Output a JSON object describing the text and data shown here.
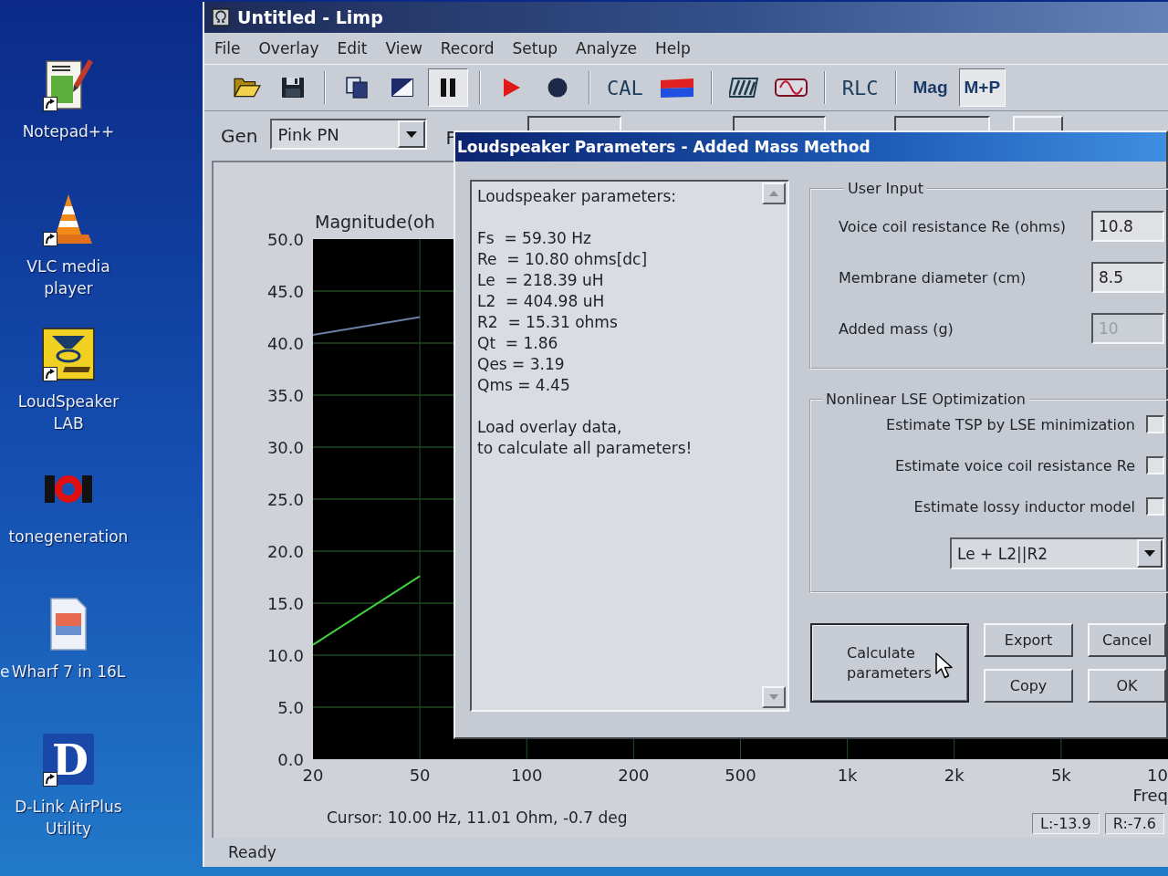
{
  "desktop": {
    "icons": [
      {
        "label": "Notepad++",
        "shortcut": true
      },
      {
        "label": "VLC media player",
        "shortcut": true
      },
      {
        "label": "LoudSpeaker LAB",
        "shortcut": true
      },
      {
        "label": "tonegeneration",
        "shortcut": false
      },
      {
        "label": "Wharf 7 in 16L",
        "shortcut": false
      },
      {
        "label": "D-Link AirPlus Utility",
        "shortcut": true,
        "glyph": "D"
      }
    ],
    "cut_label": "e"
  },
  "window": {
    "title": "Untitled - Limp"
  },
  "menu": [
    "File",
    "Overlay",
    "Edit",
    "View",
    "Record",
    "Setup",
    "Analyze",
    "Help"
  ],
  "toolbar": [
    [
      {
        "kind": "icon",
        "pressed": false
      },
      {
        "kind": "icon",
        "pressed": false
      }
    ],
    [
      {
        "kind": "icon",
        "pressed": false
      },
      {
        "kind": "icon",
        "pressed": false
      },
      {
        "kind": "icon",
        "pressed": true
      }
    ],
    [
      {
        "kind": "icon",
        "pressed": false
      },
      {
        "kind": "icon",
        "pressed": false
      }
    ],
    [
      {
        "kind": "text",
        "label": "CAL",
        "pressed": false
      },
      {
        "kind": "icon",
        "pressed": false
      }
    ],
    [
      {
        "kind": "icon",
        "pressed": false
      },
      {
        "kind": "icon",
        "pressed": false
      }
    ],
    [
      {
        "kind": "text",
        "label": "RLC",
        "pressed": false
      }
    ],
    [
      {
        "kind": "bold",
        "label": "Mag",
        "pressed": false
      },
      {
        "kind": "bold",
        "label": "M+P",
        "pressed": true
      }
    ]
  ],
  "generator": {
    "label": "Gen",
    "value": "Pink PN",
    "cut_label": "F"
  },
  "chart": {
    "chart_data": {
      "type": "line",
      "title": "Magnitude(oh",
      "xlabel": "Freq",
      "categories": [
        "20",
        "50",
        "100",
        "200",
        "500",
        "1k",
        "2k",
        "5k"
      ],
      "series": [
        {
          "color": "#6b7fa3",
          "values": [
            40.8,
            42.5,
            null,
            null,
            null,
            null,
            null,
            null
          ]
        },
        {
          "color": "#3fcf3f",
          "values": [
            11.0,
            17.6,
            null,
            null,
            null,
            null,
            null,
            null
          ]
        }
      ],
      "ylim": [
        0,
        50
      ],
      "yticks": [
        {
          "value": 0,
          "label": "0.0"
        },
        {
          "value": 5,
          "label": "5.0"
        },
        {
          "value": 10,
          "label": "10.0"
        },
        {
          "value": 15,
          "label": "15.0"
        },
        {
          "value": 20,
          "label": "20.0"
        },
        {
          "value": 25,
          "label": "25.0"
        },
        {
          "value": 30,
          "label": "30.0"
        },
        {
          "value": 35,
          "label": "35.0"
        },
        {
          "value": 40,
          "label": "40.0"
        },
        {
          "value": 45,
          "label": "45.0"
        },
        {
          "value": 50,
          "label": "50.0"
        }
      ],
      "grid": true
    },
    "edge_tick_label": "10",
    "cursor": "Cursor: 10.00 Hz, 11.01 Ohm, -0.7 deg",
    "readouts": [
      "L:-13.9",
      "R:-7.6"
    ]
  },
  "status_bar": "Ready",
  "dialog": {
    "title": "Loudspeaker Parameters - Added Mass Method",
    "results": {
      "heading": "Loudspeaker parameters:",
      "lines": [
        "Fs  = 59.30 Hz",
        "Re  = 10.80 ohms[dc]",
        "Le  = 218.39 uH",
        "L2  = 404.98 uH",
        "R2  = 15.31 ohms",
        "Qt  = 1.86",
        "Qes = 3.19",
        "Qms = 4.45"
      ],
      "note": "Load overlay data,\nto calculate all parameters!"
    },
    "user_input": {
      "title": "User Input",
      "fields": [
        {
          "label": "Voice coil resistance Re (ohms)",
          "value": "10.8",
          "disabled": false
        },
        {
          "label": "Membrane diameter (cm)",
          "value": "8.5",
          "disabled": false
        },
        {
          "label": "Added mass (g)",
          "value": "10",
          "disabled": true
        }
      ]
    },
    "optimization": {
      "title": "Nonlinear LSE Optimization",
      "options": [
        {
          "label": "Estimate TSP by LSE minimization",
          "checked": false
        },
        {
          "label": "Estimate voice coil resistance Re",
          "checked": false
        },
        {
          "label": "Estimate lossy inductor model",
          "checked": false
        }
      ],
      "model": "Le + L2||R2"
    },
    "buttons": [
      {
        "label": "Calculate parameters",
        "default": true
      },
      {
        "label": "Export",
        "default": false
      },
      {
        "label": "Cancel",
        "default": false
      },
      {
        "label": "Copy",
        "default": false
      },
      {
        "label": "OK",
        "default": false
      }
    ]
  }
}
